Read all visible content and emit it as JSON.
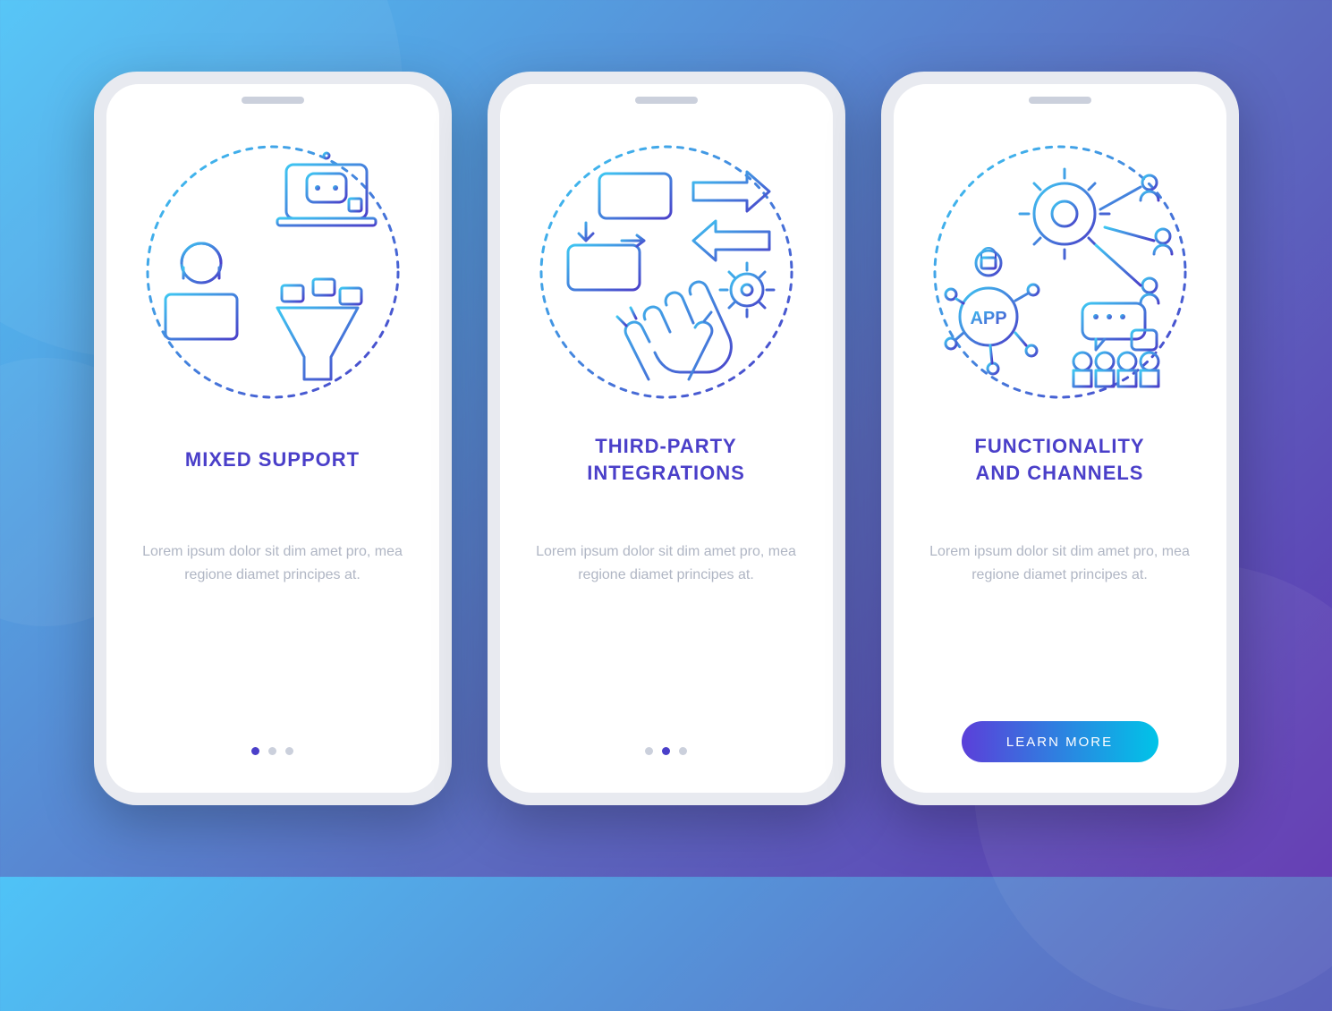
{
  "colors": {
    "accent": "#4A3FC9",
    "body_text": "#B0B6C4",
    "gradient_start": "#5B3FD9",
    "gradient_end": "#00C4E8"
  },
  "screens": [
    {
      "illustration": "mixed-support-icon",
      "title": "MIXED SUPPORT",
      "body": "Lorem ipsum dolor sit dim amet pro, mea regione diamet principes at.",
      "active_dot": 0,
      "has_cta": false
    },
    {
      "illustration": "third-party-integrations-icon",
      "title": "THIRD-PARTY\nINTEGRATIONS",
      "body": "Lorem ipsum dolor sit dim amet pro, mea regione diamet principes at.",
      "active_dot": 1,
      "has_cta": false
    },
    {
      "illustration": "functionality-channels-icon",
      "title": "FUNCTIONALITY\nAND CHANNELS",
      "body": "Lorem ipsum dolor sit dim amet pro, mea regione diamet principes at.",
      "active_dot": 2,
      "has_cta": true,
      "cta_label": "LEARN MORE"
    }
  ]
}
